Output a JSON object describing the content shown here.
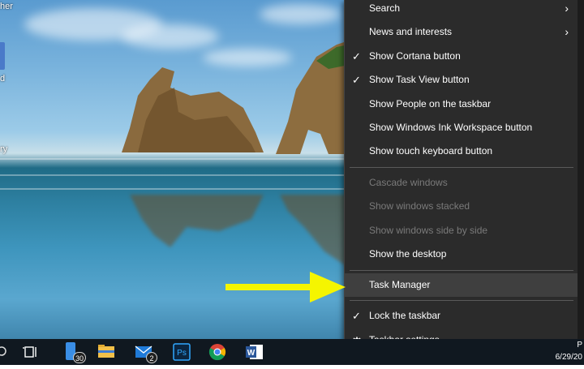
{
  "desktop": {
    "left_fragments": [
      "her",
      "d",
      "ry"
    ]
  },
  "context_menu": {
    "items": [
      {
        "label": "Search",
        "check": false,
        "submenu": true,
        "disabled": false
      },
      {
        "label": "News and interests",
        "check": false,
        "submenu": true,
        "disabled": false
      },
      {
        "label": "Show Cortana button",
        "check": true,
        "submenu": false,
        "disabled": false
      },
      {
        "label": "Show Task View button",
        "check": true,
        "submenu": false,
        "disabled": false
      },
      {
        "label": "Show People on the taskbar",
        "check": false,
        "submenu": false,
        "disabled": false
      },
      {
        "label": "Show Windows Ink Workspace button",
        "check": false,
        "submenu": false,
        "disabled": false
      },
      {
        "label": "Show touch keyboard button",
        "check": false,
        "submenu": false,
        "disabled": false
      },
      {
        "label": "Cascade windows",
        "check": false,
        "submenu": false,
        "disabled": true
      },
      {
        "label": "Show windows stacked",
        "check": false,
        "submenu": false,
        "disabled": true
      },
      {
        "label": "Show windows side by side",
        "check": false,
        "submenu": false,
        "disabled": true
      },
      {
        "label": "Show the desktop",
        "check": false,
        "submenu": false,
        "disabled": false
      },
      {
        "label": "Task Manager",
        "check": false,
        "submenu": false,
        "disabled": false,
        "highlighted": true
      },
      {
        "label": "Lock the taskbar",
        "check": true,
        "submenu": false,
        "disabled": false
      },
      {
        "label": "Taskbar settings",
        "check": false,
        "submenu": false,
        "disabled": false,
        "icon": "gear-icon"
      }
    ],
    "check_glyph": "✓",
    "arrow_glyph": "›"
  },
  "annotation": {
    "color": "#f5f500",
    "points_to": "Task Manager"
  },
  "taskbar": {
    "icons": [
      {
        "name": "search-fragment-icon"
      },
      {
        "name": "task-view-icon"
      },
      {
        "name": "phone-app-icon",
        "badge": "30"
      },
      {
        "name": "file-explorer-icon"
      },
      {
        "name": "mail-icon",
        "badge": "2"
      },
      {
        "name": "photoshop-icon",
        "text": "Ps"
      },
      {
        "name": "chrome-icon"
      },
      {
        "name": "word-icon",
        "text": "W"
      }
    ],
    "clock_fragment_top": "P",
    "clock_fragment_bottom": "6/29/20"
  },
  "colors": {
    "menu_bg": "#2b2b2b",
    "menu_disabled": "#7a7a7a",
    "menu_highlight": "#3f3f3f",
    "taskbar_bg": "#101820"
  }
}
